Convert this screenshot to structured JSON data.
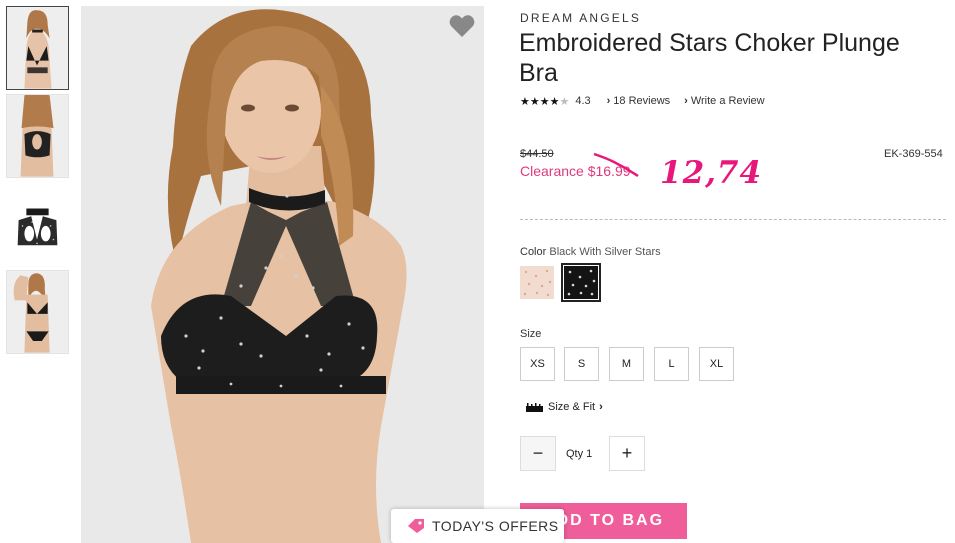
{
  "product": {
    "brand": "DREAM ANGELS",
    "title": "Embroidered Stars Choker Plunge Bra",
    "rating": "4.3",
    "stars": "★★★★",
    "reviews_label": "18 Reviews",
    "write_review_label": "Write a Review",
    "old_price": "$44.50",
    "clearance_price": "Clearance $16.99",
    "handwritten_price": "12,74",
    "sku": "EK-369-554"
  },
  "color": {
    "label": "Color",
    "value": "Black With Silver Stars",
    "swatches": [
      "Nude Blush",
      "Black With Silver Stars"
    ]
  },
  "size": {
    "label": "Size",
    "options": [
      "XS",
      "S",
      "M",
      "L",
      "XL"
    ],
    "size_fit_label": "Size & Fit"
  },
  "quantity": {
    "minus": "−",
    "label": "Qty 1",
    "plus": "+"
  },
  "actions": {
    "add_to_bag": "ADD TO BAG",
    "todays_offers": "TODAY'S OFFERS"
  },
  "colors": {
    "accent_pink": "#ef5e9a",
    "clearance_pink": "#e0397e",
    "handwritten_pink": "#e8177c"
  },
  "icons": [
    "heart-icon",
    "star-icon",
    "chevron-right-icon",
    "ruler-icon",
    "tag-icon"
  ]
}
